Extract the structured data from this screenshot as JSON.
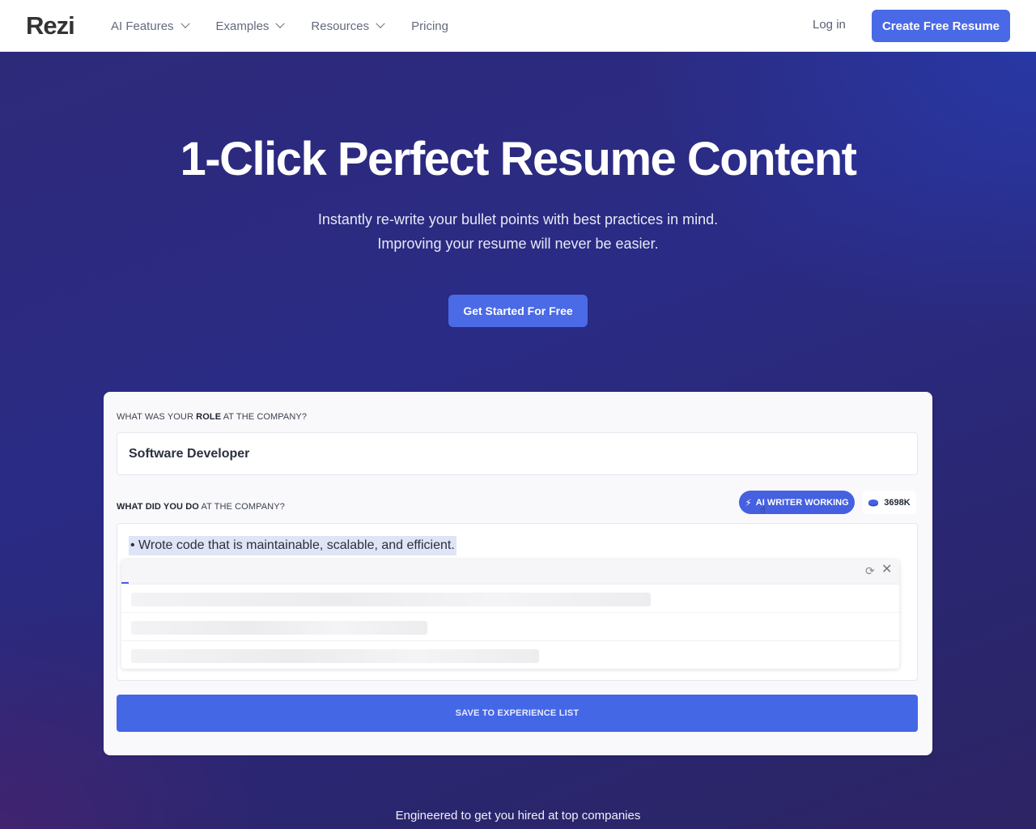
{
  "header": {
    "logo": "Rezi",
    "nav": [
      {
        "label": "AI Features",
        "has_dropdown": true
      },
      {
        "label": "Examples",
        "has_dropdown": true
      },
      {
        "label": "Resources",
        "has_dropdown": true
      },
      {
        "label": "Pricing",
        "has_dropdown": false
      }
    ],
    "login_label": "Log in",
    "create_label": "Create Free Resume"
  },
  "hero": {
    "title": "1-Click Perfect Resume Content",
    "subtitle_line1": "Instantly re-write your bullet points with best practices in mind.",
    "subtitle_line2": "Improving your resume will never be easier.",
    "cta_label": "Get Started For Free"
  },
  "demo": {
    "role_label_pre": "WHAT WAS YOUR ",
    "role_label_bold": "ROLE",
    "role_label_post": " AT THE COMPANY?",
    "role_value": "Software Developer",
    "do_label_bold": "WHAT DID YOU DO",
    "do_label_post": " AT THE COMPANY?",
    "ai_status_label": "AI WRITER WORKING",
    "credits": "3698K",
    "bullet_text": "• Wrote code that is maintainable, scalable, and efficient.",
    "suggestions_loading": true,
    "loading_progress_percent": 1,
    "save_label": "SAVE TO EXPERIENCE LIST"
  },
  "colors": {
    "accent": "#4969e6",
    "hero_bg": "#2a2b85",
    "card_bg": "#f9f9fb"
  },
  "tagline": "Engineered to get you hired at top companies"
}
